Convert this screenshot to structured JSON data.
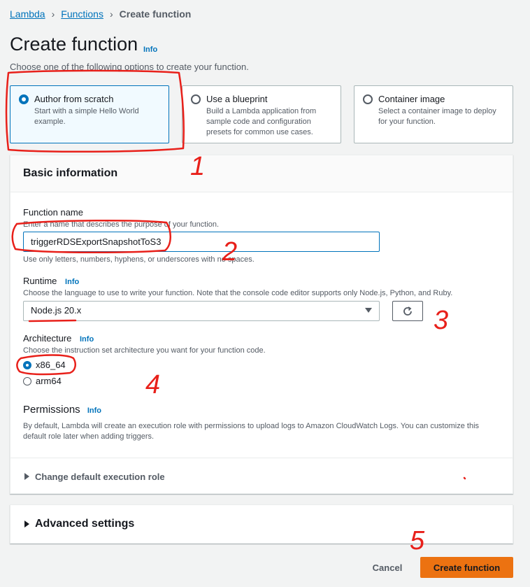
{
  "breadcrumb": {
    "items": [
      "Lambda",
      "Functions"
    ],
    "current": "Create function"
  },
  "page": {
    "title": "Create function",
    "info": "Info",
    "subtitle": "Choose one of the following options to create your function."
  },
  "options": [
    {
      "title": "Author from scratch",
      "desc": "Start with a simple Hello World example.",
      "selected": true
    },
    {
      "title": "Use a blueprint",
      "desc": "Build a Lambda application from sample code and configuration presets for common use cases.",
      "selected": false
    },
    {
      "title": "Container image",
      "desc": "Select a container image to deploy for your function.",
      "selected": false
    }
  ],
  "basic": {
    "header": "Basic information",
    "function_name": {
      "label": "Function name",
      "desc": "Enter a name that describes the purpose of your function.",
      "value": "triggerRDSExportSnapshotToS3",
      "constraint": "Use only letters, numbers, hyphens, or underscores with no spaces."
    },
    "runtime": {
      "label": "Runtime",
      "info": "Info",
      "desc": "Choose the language to use to write your function. Note that the console code editor supports only Node.js, Python, and Ruby.",
      "value": "Node.js 20.x"
    },
    "architecture": {
      "label": "Architecture",
      "info": "Info",
      "desc": "Choose the instruction set architecture you want for your function code.",
      "options": [
        "x86_64",
        "arm64"
      ],
      "selected": "x86_64"
    },
    "permissions": {
      "title": "Permissions",
      "info": "Info",
      "desc": "By default, Lambda will create an execution role with permissions to upload logs to Amazon CloudWatch Logs. You can customize this default role later when adding triggers."
    },
    "change_role": "Change default execution role"
  },
  "advanced": "Advanced settings",
  "footer": {
    "cancel": "Cancel",
    "create": "Create function"
  },
  "annotations": {
    "color": "#e8201a",
    "labels": [
      "1",
      "2",
      "3",
      "4",
      "5"
    ]
  },
  "colors": {
    "link": "#0073bb",
    "primary": "#ec7211",
    "selected_bg": "#f1faff"
  }
}
